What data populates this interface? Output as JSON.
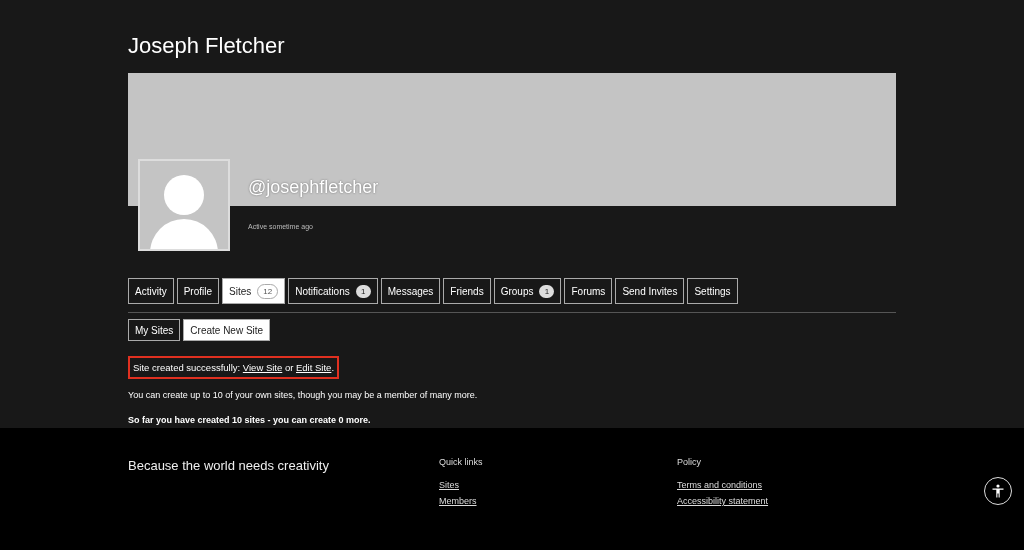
{
  "profile": {
    "name": "Joseph Fletcher",
    "username": "@josephfletcher",
    "activity": "Active sometime ago"
  },
  "tabs": [
    {
      "label": "Activity",
      "selected": false
    },
    {
      "label": "Profile",
      "selected": false
    },
    {
      "label": "Sites",
      "count": "12",
      "selected": true
    },
    {
      "label": "Notifications",
      "count": "1",
      "selected": false
    },
    {
      "label": "Messages",
      "selected": false
    },
    {
      "label": "Friends",
      "selected": false
    },
    {
      "label": "Groups",
      "count": "1",
      "selected": false
    },
    {
      "label": "Forums",
      "selected": false
    },
    {
      "label": "Send Invites",
      "selected": false
    },
    {
      "label": "Settings",
      "selected": false
    }
  ],
  "subtabs": [
    {
      "label": "My Sites",
      "selected": false
    },
    {
      "label": "Create New Site",
      "selected": true
    }
  ],
  "notice": {
    "text": "Site created successfully:",
    "link_1": "View Site",
    "joiner": "or",
    "link_2": "Edit Site",
    "end": "."
  },
  "info": "You can create up to 10 of your own sites, though you may be a member of many more.",
  "summary": "So far you have created 10 sites - you can create 0 more.",
  "footer": {
    "tagline": "Because the world needs creativity",
    "columns": [
      {
        "heading": "Quick links",
        "links": [
          "Sites",
          "Members"
        ]
      },
      {
        "heading": "Policy",
        "links": [
          "Terms and conditions",
          "Accessibility statement"
        ]
      }
    ]
  }
}
